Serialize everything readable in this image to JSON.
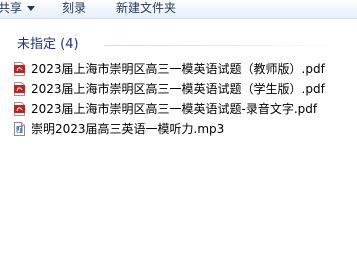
{
  "toolbar": {
    "share_label": "共享",
    "burn_label": "刻录",
    "new_folder_label": "新建文件夹"
  },
  "group": {
    "title": "未指定 (4)"
  },
  "files": [
    {
      "name": "2023届上海市崇明区高三一模英语试题（教师版）.pdf",
      "icon": "pdf-icon"
    },
    {
      "name": "2023届上海市崇明区高三一模英语试题（学生版）.pdf",
      "icon": "pdf-icon"
    },
    {
      "name": "2023届上海市崇明区高三一模英语试题-录音文字.pdf",
      "icon": "pdf-icon"
    },
    {
      "name": "崇明2023届高三英语一模听力.mp3",
      "icon": "audio-file-icon"
    }
  ],
  "colors": {
    "pdf_red": "#c8201d",
    "group_title": "#1e3287",
    "toolbar_text": "#1e395b"
  }
}
